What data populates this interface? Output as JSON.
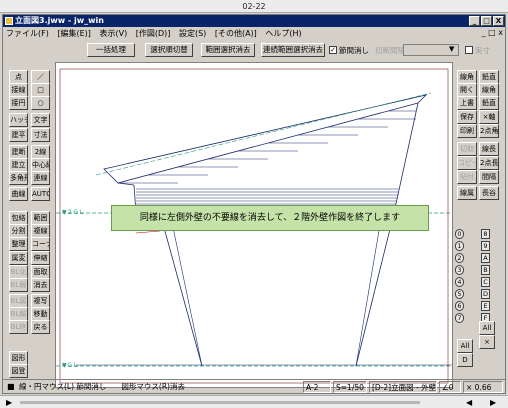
{
  "player": {
    "title": "02-22"
  },
  "window": {
    "title": "立面図3.jww - jw_win",
    "min": "_",
    "max": "□",
    "close": "X"
  },
  "menu": [
    "ファイル(F)",
    "[編集(E)]",
    "表示(V)",
    "[作図(D)]",
    "設定(S)",
    "[その他(A)]",
    "ヘルプ(H)"
  ],
  "mdi": {
    "min": "_",
    "max": "□",
    "close": "x"
  },
  "toolbar": {
    "batch": "一括処理",
    "b1": "選択順切替",
    "b2": "範囲選択消去",
    "b3": "連続範囲選択消去",
    "checkbox_label": "節間消し",
    "cut_label": "切断間隔",
    "combo_value": "",
    "solid_label": "実寸",
    "checkbox_mark": "✓"
  },
  "left_tools": [
    [
      "点",
      "／"
    ],
    [
      "接線",
      "□"
    ],
    [
      "接円",
      "○"
    ],
    [
      "ハッチ",
      "文字"
    ],
    [
      "建平",
      "寸法"
    ],
    [
      "建断",
      "2線"
    ],
    [
      "建立",
      "中心線"
    ],
    [
      "多角形",
      "連線"
    ],
    [
      "曲線",
      "AUTO"
    ],
    [
      "包絡",
      "範囲"
    ],
    [
      "分割",
      "複線"
    ],
    [
      "整理",
      "コーナー"
    ],
    [
      "属変",
      "伸縮"
    ],
    [
      "BL化",
      "面取"
    ],
    [
      "BL解",
      "消去"
    ],
    [
      "BL属",
      "複写"
    ],
    [
      "BL編",
      "移動"
    ],
    [
      "BL終",
      "戻る"
    ],
    [
      "図形",
      ""
    ],
    [
      "図登",
      ""
    ]
  ],
  "right_tools": [
    [
      "線角",
      "鉛直"
    ],
    [
      "開く",
      "線角"
    ],
    [
      "上書",
      "鉛直"
    ],
    [
      "保存",
      "×軸"
    ],
    [
      "印刷",
      "2点角"
    ],
    [
      "切取",
      "線長"
    ],
    [
      "コピー",
      "2点長"
    ],
    [
      "貼付",
      "間隔"
    ],
    [
      "線属",
      "長谷"
    ]
  ],
  "layers": {
    "groups": [
      "0",
      "1",
      "2",
      "3",
      "4",
      "5",
      "6",
      "7",
      "8",
      "9",
      "A",
      "B",
      "C",
      "D",
      "E",
      "F"
    ],
    "all": "All",
    "current": "D",
    "close": "×"
  },
  "callout": "同様に左側外壁の不要線を消去して、２階外壁作図を終了します",
  "gl_labels": [
    "▼２ＧＬ",
    "▼ＧＬ"
  ],
  "status": {
    "message": "線・円マウス(L) 節間消し　　図形マウス(R)消去",
    "paper": "A-2",
    "scale": "S=1/50",
    "layer": "[D-2]立面図 - 外壁",
    "angle": "∠0",
    "zoom": "× 0.66"
  },
  "colors": {
    "titlebar": "#0a246a",
    "callout_bg": "#c5e3a8",
    "drawing_line": "#1a2a6a",
    "guide_line": "#2a9a7a",
    "red_line": "#c00000"
  }
}
